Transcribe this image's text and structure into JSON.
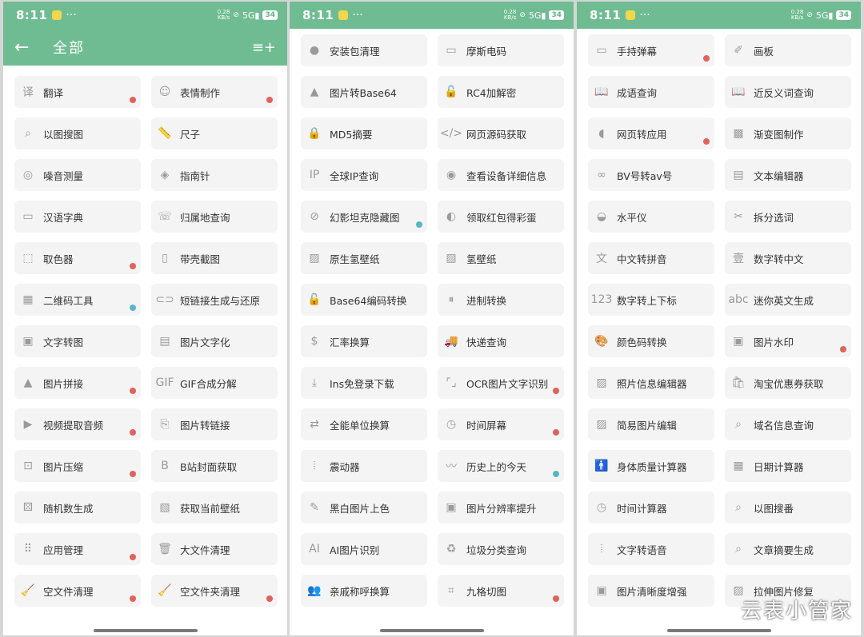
{
  "status": {
    "time": "8:11",
    "more": "···",
    "net_top": "0.28",
    "net_bottom": "KB/s",
    "signal": "5G",
    "battery": "34"
  },
  "header": {
    "back_icon": "←",
    "title": "全部",
    "menu_icon": "≡+"
  },
  "colors": {
    "accent": "#6fbc92",
    "badge_red": "#e0625d",
    "badge_teal": "#54b8c4"
  },
  "panel1": [
    {
      "label": "翻译",
      "icon": "translate-icon",
      "glyph": "译",
      "badge": "red"
    },
    {
      "label": "表情制作",
      "icon": "emoji-icon",
      "glyph": "☺",
      "badge": "red"
    },
    {
      "label": "以图搜图",
      "icon": "image-search-icon",
      "glyph": "⌕",
      "badge": ""
    },
    {
      "label": "尺子",
      "icon": "ruler-icon",
      "glyph": "📏",
      "badge": ""
    },
    {
      "label": "噪音测量",
      "icon": "noise-icon",
      "glyph": "◎",
      "badge": ""
    },
    {
      "label": "指南针",
      "icon": "compass-icon",
      "glyph": "◈",
      "badge": ""
    },
    {
      "label": "汉语字典",
      "icon": "dictionary-icon",
      "glyph": "▭",
      "badge": ""
    },
    {
      "label": "归属地查询",
      "icon": "phone-icon",
      "glyph": "☏",
      "badge": ""
    },
    {
      "label": "取色器",
      "icon": "color-picker-icon",
      "glyph": "⬚",
      "badge": "red"
    },
    {
      "label": "带壳截图",
      "icon": "phone-frame-icon",
      "glyph": "▯",
      "badge": ""
    },
    {
      "label": "二维码工具",
      "icon": "qrcode-icon",
      "glyph": "▦",
      "badge": "teal"
    },
    {
      "label": "短链接生成与还原",
      "icon": "link-icon",
      "glyph": "⊂⊃",
      "badge": ""
    },
    {
      "label": "文字转图",
      "icon": "text-image-icon",
      "glyph": "▣",
      "badge": ""
    },
    {
      "label": "图片文字化",
      "icon": "image-text-icon",
      "glyph": "▤",
      "badge": ""
    },
    {
      "label": "图片拼接",
      "icon": "image-join-icon",
      "glyph": "▲",
      "badge": "red"
    },
    {
      "label": "GIF合成分解",
      "icon": "gif-icon",
      "glyph": "GIF",
      "badge": ""
    },
    {
      "label": "视频提取音频",
      "icon": "video-audio-icon",
      "glyph": "▶",
      "badge": "red"
    },
    {
      "label": "图片转链接",
      "icon": "image-link-icon",
      "glyph": "⎘",
      "badge": ""
    },
    {
      "label": "图片压缩",
      "icon": "image-compress-icon",
      "glyph": "⊡",
      "badge": "red"
    },
    {
      "label": "B站封面获取",
      "icon": "bilibili-icon",
      "glyph": "B",
      "badge": ""
    },
    {
      "label": "随机数生成",
      "icon": "dice-icon",
      "glyph": "⚄",
      "badge": ""
    },
    {
      "label": "获取当前壁纸",
      "icon": "wallpaper-icon",
      "glyph": "▧",
      "badge": ""
    },
    {
      "label": "应用管理",
      "icon": "apps-icon",
      "glyph": "⠿",
      "badge": "red"
    },
    {
      "label": "大文件清理",
      "icon": "trash-icon",
      "glyph": "🗑",
      "badge": ""
    },
    {
      "label": "空文件清理",
      "icon": "broom-icon",
      "glyph": "🧹",
      "badge": "red"
    },
    {
      "label": "空文件夹清理",
      "icon": "broom-icon",
      "glyph": "🧹",
      "badge": "red"
    }
  ],
  "panel2": [
    {
      "label": "安装包清理",
      "icon": "package-icon",
      "glyph": "●",
      "badge": ""
    },
    {
      "label": "摩斯电码",
      "icon": "morse-icon",
      "glyph": "▭",
      "badge": ""
    },
    {
      "label": "图片转Base64",
      "icon": "image-base64-icon",
      "glyph": "▲",
      "badge": ""
    },
    {
      "label": "RC4加解密",
      "icon": "lock-icon",
      "glyph": "🔓",
      "badge": ""
    },
    {
      "label": "MD5摘要",
      "icon": "lock-icon",
      "glyph": "🔒",
      "badge": ""
    },
    {
      "label": "网页源码获取",
      "icon": "code-icon",
      "glyph": "</>",
      "badge": ""
    },
    {
      "label": "全球IP查询",
      "icon": "ip-icon",
      "glyph": "IP",
      "badge": ""
    },
    {
      "label": "查看设备详细信息",
      "icon": "device-icon",
      "glyph": "◉",
      "badge": ""
    },
    {
      "label": "幻影坦克隐藏图",
      "icon": "hidden-image-icon",
      "glyph": "⊘",
      "badge": "teal"
    },
    {
      "label": "领取红包得彩蛋",
      "icon": "egg-icon",
      "glyph": "◐",
      "badge": ""
    },
    {
      "label": "原生氢壁纸",
      "icon": "wallpaper-icon",
      "glyph": "▨",
      "badge": ""
    },
    {
      "label": "氢壁纸",
      "icon": "wallpaper-icon",
      "glyph": "▨",
      "badge": ""
    },
    {
      "label": "Base64编码转换",
      "icon": "lock-icon",
      "glyph": "🔓",
      "badge": ""
    },
    {
      "label": "进制转换",
      "icon": "convert-icon",
      "glyph": "⏸",
      "badge": ""
    },
    {
      "label": "汇率换算",
      "icon": "currency-icon",
      "glyph": "$",
      "badge": ""
    },
    {
      "label": "快递查询",
      "icon": "truck-icon",
      "glyph": "🚚",
      "badge": ""
    },
    {
      "label": "Ins免登录下载",
      "icon": "download-icon",
      "glyph": "⤓",
      "badge": ""
    },
    {
      "label": "OCR图片文字识别",
      "icon": "ocr-icon",
      "glyph": "⌜⌟",
      "badge": "red"
    },
    {
      "label": "全能单位换算",
      "icon": "unit-icon",
      "glyph": "⇄",
      "badge": ""
    },
    {
      "label": "时间屏幕",
      "icon": "clock-icon",
      "glyph": "◷",
      "badge": "red"
    },
    {
      "label": "震动器",
      "icon": "vibrate-icon",
      "glyph": "⦙",
      "badge": ""
    },
    {
      "label": "历史上的今天",
      "icon": "trend-icon",
      "glyph": "〰",
      "badge": "teal"
    },
    {
      "label": "黑白图片上色",
      "icon": "brush-icon",
      "glyph": "✎",
      "badge": ""
    },
    {
      "label": "图片分辨率提升",
      "icon": "resolution-icon",
      "glyph": "▣",
      "badge": ""
    },
    {
      "label": "AI图片识别",
      "icon": "ai-icon",
      "glyph": "AI",
      "badge": ""
    },
    {
      "label": "垃圾分类查询",
      "icon": "recycle-icon",
      "glyph": "♻",
      "badge": ""
    },
    {
      "label": "亲戚称呼换算",
      "icon": "people-icon",
      "glyph": "👥",
      "badge": ""
    },
    {
      "label": "九格切图",
      "icon": "crop-icon",
      "glyph": "⌗",
      "badge": "red"
    }
  ],
  "panel3": [
    {
      "label": "手持弹幕",
      "icon": "barrage-icon",
      "glyph": "▭",
      "badge": "red"
    },
    {
      "label": "画板",
      "icon": "paint-icon",
      "glyph": "✐",
      "badge": ""
    },
    {
      "label": "成语查询",
      "icon": "book-icon",
      "glyph": "📖",
      "badge": ""
    },
    {
      "label": "近反义词查询",
      "icon": "book-icon",
      "glyph": "📖",
      "badge": ""
    },
    {
      "label": "网页转应用",
      "icon": "android-icon",
      "glyph": "◖",
      "badge": "red"
    },
    {
      "label": "渐变图制作",
      "icon": "gradient-icon",
      "glyph": "▩",
      "badge": ""
    },
    {
      "label": "BV号转av号",
      "icon": "link-icon",
      "glyph": "∞",
      "badge": ""
    },
    {
      "label": "文本编辑器",
      "icon": "document-icon",
      "glyph": "▤",
      "badge": ""
    },
    {
      "label": "水平仪",
      "icon": "level-icon",
      "glyph": "◒",
      "badge": ""
    },
    {
      "label": "拆分选词",
      "icon": "split-icon",
      "glyph": "✂",
      "badge": ""
    },
    {
      "label": "中文转拼音",
      "icon": "pinyin-icon",
      "glyph": "文",
      "badge": ""
    },
    {
      "label": "数字转中文",
      "icon": "number-icon",
      "glyph": "壹",
      "badge": ""
    },
    {
      "label": "数字转上下标",
      "icon": "superscript-icon",
      "glyph": "123",
      "badge": ""
    },
    {
      "label": "迷你英文生成",
      "icon": "abc-icon",
      "glyph": "abc",
      "badge": ""
    },
    {
      "label": "颜色码转换",
      "icon": "palette-icon",
      "glyph": "🎨",
      "badge": ""
    },
    {
      "label": "图片水印",
      "icon": "watermark-icon",
      "glyph": "▣",
      "badge": "red"
    },
    {
      "label": "照片信息编辑器",
      "icon": "photo-edit-icon",
      "glyph": "▨",
      "badge": ""
    },
    {
      "label": "淘宝优惠券获取",
      "icon": "bag-icon",
      "glyph": "🛍",
      "badge": ""
    },
    {
      "label": "简易图片编辑",
      "icon": "image-edit-icon",
      "glyph": "▨",
      "badge": ""
    },
    {
      "label": "域名信息查询",
      "icon": "domain-icon",
      "glyph": "⌕",
      "badge": ""
    },
    {
      "label": "身体质量计算器",
      "icon": "body-icon",
      "glyph": "🚹",
      "badge": ""
    },
    {
      "label": "日期计算器",
      "icon": "calendar-icon",
      "glyph": "▦",
      "badge": ""
    },
    {
      "label": "时间计算器",
      "icon": "timer-icon",
      "glyph": "◷",
      "badge": ""
    },
    {
      "label": "以图搜番",
      "icon": "image-search-icon",
      "glyph": "⌕",
      "badge": ""
    },
    {
      "label": "文字转语音",
      "icon": "audio-icon",
      "glyph": "⦙",
      "badge": ""
    },
    {
      "label": "文章摘要生成",
      "icon": "summary-icon",
      "glyph": "⌕",
      "badge": ""
    },
    {
      "label": "图片清晰度增强",
      "icon": "enhance-icon",
      "glyph": "▣",
      "badge": ""
    },
    {
      "label": "拉伸图片修复",
      "icon": "stretch-icon",
      "glyph": "▨",
      "badge": ""
    }
  ],
  "watermark": "云表小管家"
}
